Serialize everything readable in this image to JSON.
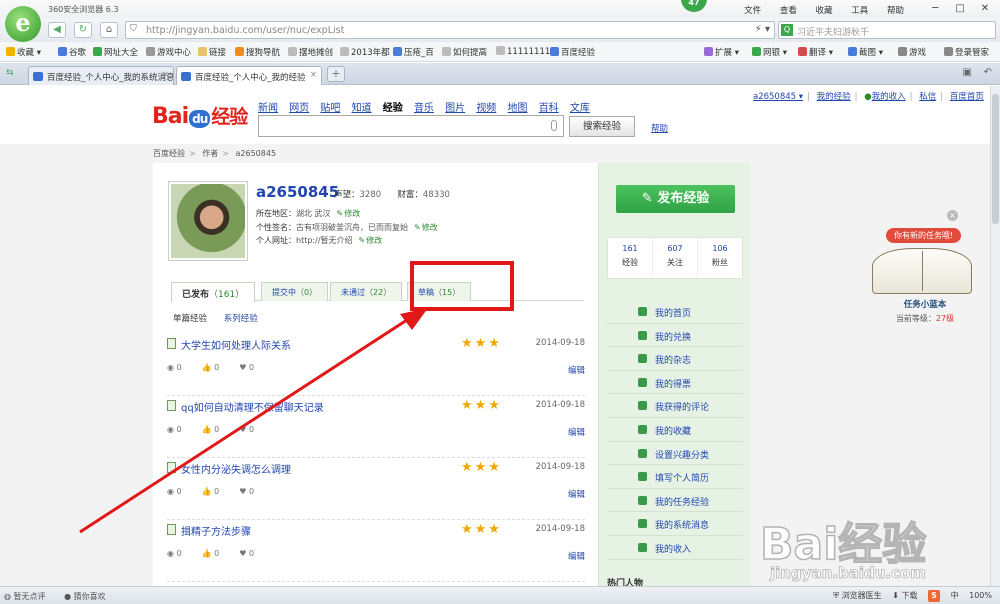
{
  "browser": {
    "title": "360安全浏览器 6.3",
    "logo_glyph": "e",
    "badge": "47",
    "menus": [
      "文件",
      "查看",
      "收藏",
      "工具",
      "帮助"
    ],
    "window_buttons": [
      "─",
      "□",
      "✕"
    ],
    "address": "http://jingyan.baidu.com/user/nuc/expList",
    "search_placeholder": "习近平夫妇游秋千",
    "search_icon_label": "Q",
    "favorites": [
      "收藏",
      "谷歌",
      "网址大全",
      "游戏中心",
      "链接",
      "搜狗导航",
      "摆地摊创",
      "2013年都",
      "压疮_百",
      "如何提高",
      "11111111",
      "百度经验"
    ],
    "right_tools": [
      "扩展",
      "网银",
      "翻译",
      "截图",
      "游戏",
      "登录管家"
    ],
    "tabs": [
      {
        "label": "百度经验_个人中心_我的系统消息",
        "active": false
      },
      {
        "label": "百度经验_个人中心_我的经验",
        "active": true
      }
    ],
    "new_tab": "+"
  },
  "site": {
    "logo": {
      "bai": "Bai",
      "du": "du",
      "jingyan": "经验"
    },
    "nav": [
      "新闻",
      "网页",
      "贴吧",
      "知道",
      "经验",
      "音乐",
      "图片",
      "视频",
      "地图",
      "百科",
      "文库"
    ],
    "nav_current": "经验",
    "search_button": "搜索经验",
    "help": "帮助",
    "user_links": [
      "a2650845 ▾",
      "我的经验",
      "我的收入",
      "私信",
      "百度首页"
    ],
    "breadcrumb": [
      "百度经验",
      "作者",
      "a2650845"
    ]
  },
  "profile": {
    "username": "a2650845",
    "reputation_label": "声望：",
    "reputation": "3280",
    "wealth_label": "财富：",
    "wealth": "48330",
    "location_label": "所在地区：",
    "location": "湖北 武汉",
    "signature_label": "个性签名：",
    "signature": "古有项羽破釜沉舟，已而而复始",
    "url_label": "个人网址：",
    "url": "http://暂无介绍",
    "edit": "修改"
  },
  "tabs": [
    {
      "label": "已发布",
      "count": "161",
      "active": true
    },
    {
      "label": "提交中",
      "count": "0",
      "active": false
    },
    {
      "label": "未通过",
      "count": "22",
      "active": false
    },
    {
      "label": "草稿",
      "count": "15",
      "active": false
    }
  ],
  "subtabs": [
    "单篇经验",
    "系列经验"
  ],
  "articles": [
    {
      "title": "大学生如何处理人际关系",
      "date": "2014-09-18",
      "views": "0",
      "likes": "0",
      "favs": "0",
      "edit": "编辑"
    },
    {
      "title": "qq如何自动清理不保留聊天记录",
      "date": "2014-09-18",
      "views": "0",
      "likes": "0",
      "favs": "0",
      "edit": "编辑"
    },
    {
      "title": "女性内分泌失调怎么调理",
      "date": "2014-09-18",
      "views": "0",
      "likes": "0",
      "favs": "0",
      "edit": "编辑"
    },
    {
      "title": "揖精子方法步骤",
      "date": "2014-09-18",
      "views": "0",
      "likes": "0",
      "favs": "0",
      "edit": "编辑"
    }
  ],
  "rating_stars": "★★★",
  "sidebar": {
    "publish": "发布经验",
    "counts": [
      {
        "n": "161",
        "label": "经验"
      },
      {
        "n": "607",
        "label": "关注"
      },
      {
        "n": "106",
        "label": "粉丝"
      }
    ],
    "menu": [
      "我的首页",
      "我的兑换",
      "我的杂志",
      "我的得票",
      "我获得的评论",
      "我的收藏",
      "设置兴趣分类",
      "填写个人简历",
      "我的任务经验",
      "我的系统消息",
      "我的收入"
    ],
    "hot": "热门人物"
  },
  "widget": {
    "bubble": "你有新的任务哦!",
    "title": "任务小蓝本",
    "level_label": "当前等级：",
    "level": "27级"
  },
  "watermark": {
    "logo": "Bai经验",
    "url": "jingyan.baidu.com"
  },
  "statusbar": {
    "left": [
      "暂无点评",
      "猜你喜欢"
    ],
    "right": [
      "浏览器医生",
      "下载",
      "中",
      "100%"
    ],
    "s_icon": "S"
  },
  "colors": {
    "accent_green": "#2fa245",
    "link_blue": "#2246b0",
    "annotation_red": "#e01818"
  }
}
